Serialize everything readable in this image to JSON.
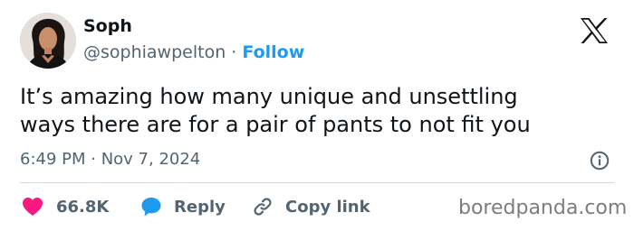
{
  "author": {
    "name": "Soph",
    "handle": "@sophiawpelton",
    "separator": "·",
    "follow_label": "Follow"
  },
  "tweet": {
    "lines": [
      "It’s amazing how many unique and unsettling",
      "ways there are for a pair of pants to not fit you"
    ],
    "timestamp": "6:49 PM · Nov 7, 2024"
  },
  "actions": {
    "likes": "66.8K",
    "reply_label": "Reply",
    "copy_link_label": "Copy link"
  },
  "watermark": "boredpanda.com",
  "icons": {
    "brand": "x-logo-icon",
    "like": "heart-icon",
    "reply": "speech-bubble-icon",
    "copy": "link-icon",
    "info": "info-icon"
  },
  "colors": {
    "accent": "#1d9bf0",
    "like": "#f91880",
    "muted_text": "#536471",
    "divider": "#cfd9de",
    "watermark": "#7d7d7d"
  }
}
